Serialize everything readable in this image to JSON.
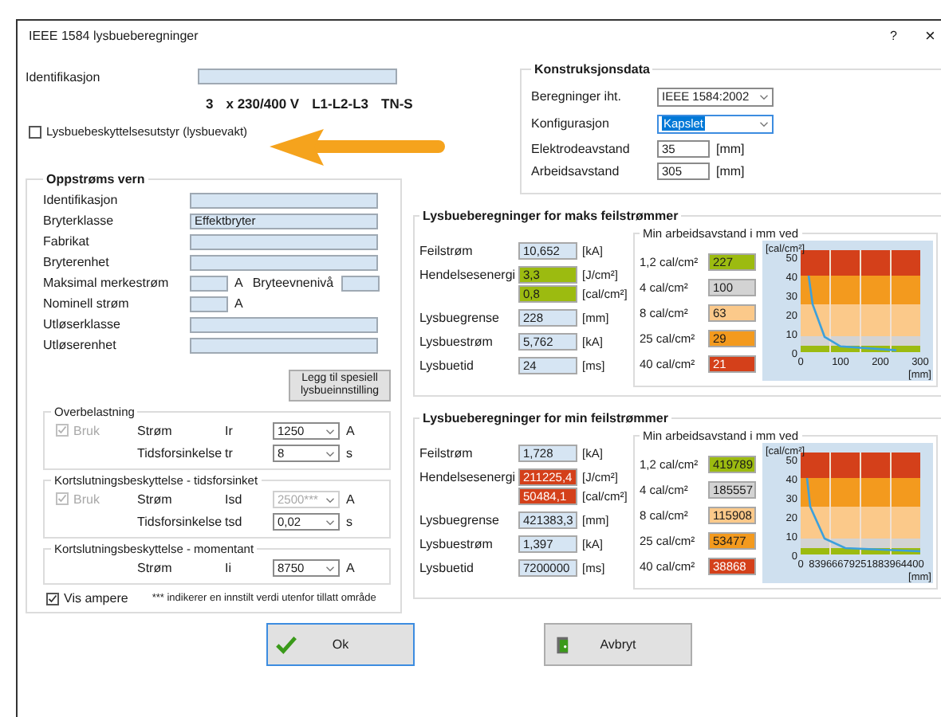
{
  "window": {
    "title": "IEEE 1584 lysbueberegninger",
    "help": "?",
    "close": "×"
  },
  "identification": {
    "label": "Identifikasjon"
  },
  "system_line": [
    "3",
    "x 230/400 V",
    "L1-L2-L3",
    "TN-S"
  ],
  "arc_protection": {
    "label": "Lysbuebeskyttelsesutstyr (lysbuevakt)",
    "checked": false
  },
  "upstream": {
    "title": "Oppstrøms vern",
    "fields": [
      {
        "kind": "field",
        "label": "Identifikasjon"
      },
      {
        "kind": "field",
        "label": "Bryterklasse",
        "value": "Effektbryter"
      },
      {
        "kind": "field",
        "label": "Fabrikat"
      },
      {
        "kind": "field",
        "label": "Bryterenhet"
      },
      {
        "kind": "pair",
        "label": "Maksimal merkestrøm",
        "unit": "A",
        "label2": "Bryteevnenivå"
      },
      {
        "kind": "unit",
        "label": "Nominell strøm",
        "unit": "A"
      },
      {
        "kind": "field",
        "label": "Utløserklasse"
      },
      {
        "kind": "field",
        "label": "Utløserenhet"
      }
    ],
    "button": "Legg til spesiell lysbueinnstilling",
    "groups": [
      {
        "title": "Overbelastning",
        "use": {
          "label": "Bruk",
          "checked": true,
          "disabled": true
        },
        "rows": [
          {
            "label": "Strøm",
            "symbol": "Ir",
            "value": "1250",
            "unit": "A",
            "disabled": false
          },
          {
            "label": "Tidsforsinkelse",
            "symbol": "tr",
            "value": "8",
            "unit": "s",
            "disabled": false
          }
        ]
      },
      {
        "title": "Kortslutningsbeskyttelse - tidsforsinket",
        "use": {
          "label": "Bruk",
          "checked": true,
          "disabled": true
        },
        "rows": [
          {
            "label": "Strøm",
            "symbol": "Isd",
            "value": "2500***",
            "unit": "A",
            "disabled": true
          },
          {
            "label": "Tidsforsinkelse",
            "symbol": "tsd",
            "value": "0,02",
            "unit": "s",
            "disabled": false
          }
        ]
      },
      {
        "title": "Kortslutningsbeskyttelse - momentant",
        "rows": [
          {
            "label": "Strøm",
            "symbol": "Ii",
            "value": "8750",
            "unit": "A",
            "disabled": false
          }
        ]
      }
    ],
    "show_amps": {
      "label": "Vis ampere",
      "checked": true
    },
    "note": "*** indikerer en innstilt verdi utenfor tillatt område"
  },
  "construction": {
    "title": "Konstruksjonsdata",
    "rows": [
      {
        "kind": "select",
        "label": "Beregninger iht.",
        "value": "IEEE 1584:2002",
        "focused": false
      },
      {
        "kind": "select",
        "label": "Konfigurasjon",
        "value": "Kapslet",
        "focused": true
      },
      {
        "kind": "input",
        "label": "Elektrodeavstand",
        "value": "35",
        "unit": "[mm]"
      },
      {
        "kind": "input",
        "label": "Arbeidsavstand",
        "value": "305",
        "unit": "[mm]"
      }
    ]
  },
  "results": [
    {
      "title": "Lysbueberegninger for maks feilstrømmer",
      "rows": [
        {
          "label": "Feilstrøm",
          "values": [
            {
              "value": "10,652",
              "unit": "[kA]",
              "color": "#d6e5f3"
            }
          ]
        },
        {
          "label": "Hendelsesenergi",
          "values": [
            {
              "value": "3,3",
              "unit": "[J/cm²]",
              "color": "#9cbb10"
            },
            {
              "value": "0,8",
              "unit": "[cal/cm²]",
              "color": "#9cbb10"
            }
          ]
        },
        {
          "label": "Lysbuegrense",
          "values": [
            {
              "value": "228",
              "unit": "[mm]",
              "color": "#d6e5f3"
            }
          ]
        },
        {
          "label": "Lysbuestrøm",
          "values": [
            {
              "value": "5,762",
              "unit": "[kA]",
              "color": "#d6e5f3"
            }
          ]
        },
        {
          "label": "Lysbuetid",
          "values": [
            {
              "value": "24",
              "unit": "[ms]",
              "color": "#d6e5f3"
            }
          ]
        }
      ],
      "distances": {
        "title": "Min arbeidsavstand i mm ved",
        "rows": [
          {
            "label": "1,2 cal/cm²",
            "value": "227",
            "color": "#9cbb10"
          },
          {
            "label": "4 cal/cm²",
            "value": "100",
            "color": "#d3d3d3"
          },
          {
            "label": "8 cal/cm²",
            "value": "63",
            "color": "#fbc98a"
          },
          {
            "label": "25 cal/cm²",
            "value": "29",
            "color": "#f39a1e"
          },
          {
            "label": "40 cal/cm²",
            "value": "21",
            "color": "#d4401a"
          }
        ]
      },
      "chart_data": {
        "type": "line",
        "xlabel": "[mm]",
        "ylabel": "[cal/cm²]",
        "xlim": [
          0,
          300
        ],
        "ylim": [
          0,
          50
        ],
        "xticks": [
          0,
          100,
          200,
          300
        ],
        "yticks": [
          0,
          10,
          20,
          30,
          40,
          50
        ],
        "series": [
          {
            "color": "#3ca0dc",
            "x": [
              20,
              30,
              60,
              100,
              240
            ],
            "values": [
              40,
              25,
              8,
              3,
              1
            ]
          }
        ]
      }
    },
    {
      "title": "Lysbueberegninger for min feilstrømmer",
      "rows": [
        {
          "label": "Feilstrøm",
          "values": [
            {
              "value": "1,728",
              "unit": "[kA]",
              "color": "#d6e5f3"
            }
          ]
        },
        {
          "label": "Hendelsesenergi",
          "values": [
            {
              "value": "211225,4",
              "unit": "[J/cm²]",
              "color": "#d4401a"
            },
            {
              "value": "50484,1",
              "unit": "[cal/cm²]",
              "color": "#d4401a"
            }
          ]
        },
        {
          "label": "Lysbuegrense",
          "values": [
            {
              "value": "421383,3",
              "unit": "[mm]",
              "color": "#d6e5f3"
            }
          ]
        },
        {
          "label": "Lysbuestrøm",
          "values": [
            {
              "value": "1,397",
              "unit": "[kA]",
              "color": "#d6e5f3"
            }
          ]
        },
        {
          "label": "Lysbuetid",
          "values": [
            {
              "value": "7200000",
              "unit": "[ms]",
              "color": "#d6e5f3"
            }
          ]
        }
      ],
      "distances": {
        "title": "Min arbeidsavstand i mm ved",
        "rows": [
          {
            "label": "1,2 cal/cm²",
            "value": "419789",
            "color": "#9cbb10"
          },
          {
            "label": "4 cal/cm²",
            "value": "185557",
            "color": "#d3d3d3"
          },
          {
            "label": "8 cal/cm²",
            "value": "115908",
            "color": "#fbc98a"
          },
          {
            "label": "25 cal/cm²",
            "value": "53477",
            "color": "#f39a1e"
          },
          {
            "label": "40 cal/cm²",
            "value": "38868",
            "color": "#d4401a"
          }
        ]
      },
      "energy_plot": {
        "ylabel": "[cal/cm²]",
        "xlabel": "[mm]",
        "y_labels": [
          "50",
          "40",
          "30",
          "20",
          "10",
          "0"
        ],
        "x_labels": [
          "0",
          "83966679251883964400"
        ]
      }
    }
  ],
  "buttons": [
    {
      "kind": "ok",
      "label": "Ok",
      "focused": true
    },
    {
      "kind": "cancel",
      "label": "Avbryt",
      "focused": false
    }
  ]
}
